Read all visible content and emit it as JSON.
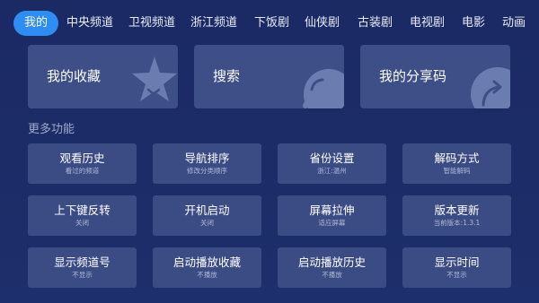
{
  "tabs": [
    "我的",
    "中央频道",
    "卫视频道",
    "浙江频道",
    "下饭剧",
    "仙侠剧",
    "古装剧",
    "电视剧",
    "电影",
    "动画"
  ],
  "cards": [
    {
      "label": "我的收藏",
      "icon": "star-icon"
    },
    {
      "label": "搜索",
      "icon": "search-bubble-icon"
    },
    {
      "label": "我的分享码",
      "icon": "share-arrow-icon"
    }
  ],
  "section_title": "更多功能",
  "features": [
    {
      "title": "观看历史",
      "sub": "看过的频道"
    },
    {
      "title": "导航排序",
      "sub": "修改分类顺序"
    },
    {
      "title": "省份设置",
      "sub": "浙江:温州"
    },
    {
      "title": "解码方式",
      "sub": "智能解码"
    },
    {
      "title": "上下键反转",
      "sub": "关闭"
    },
    {
      "title": "开机启动",
      "sub": "关闭"
    },
    {
      "title": "屏幕拉伸",
      "sub": "适应屏幕"
    },
    {
      "title": "版本更新",
      "sub": "当前版本:1.3.1"
    },
    {
      "title": "显示频道号",
      "sub": "不显示"
    },
    {
      "title": "启动播放收藏",
      "sub": "不播放"
    },
    {
      "title": "启动播放历史",
      "sub": "不播放"
    },
    {
      "title": "显示时间",
      "sub": "不显示"
    }
  ],
  "colors": {
    "active_tab": "#2e8df5",
    "card_bg": "#3e4f87",
    "background": "#1c2c67"
  }
}
